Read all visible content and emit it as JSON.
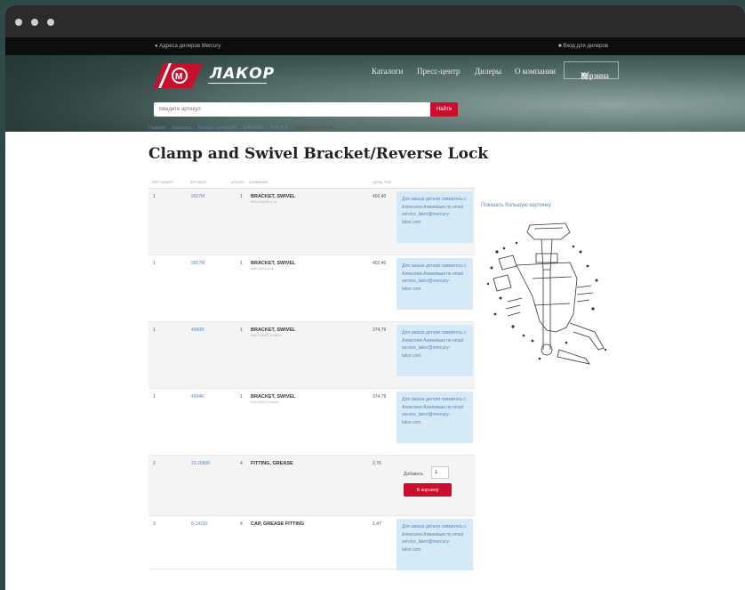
{
  "topbar": {
    "dealers_address": "Адреса дилеров Mercury",
    "dealer_login": "Вход для дилеров"
  },
  "header": {
    "logo_text": "ЛАКОР",
    "nav": [
      "Каталоги",
      "Пресс-центр",
      "Дилеры",
      "О компании"
    ],
    "cart_label": "Корзина",
    "search_placeholder": "Введите артикул",
    "search_button": "Найти"
  },
  "breadcrumb": {
    "items": [
      "Главная",
      "Каталоги",
      "Каталог запчастей",
      "MARINER",
      "6 X2 H.P."
    ],
    "separator": "→",
    "current": "Группы запчастей"
  },
  "page_title": "Clamp and Swivel Bracket/Reverse Lock",
  "table": {
    "headers": [
      "Ref номер",
      "Артикул",
      "Кол-во",
      "Название",
      "Цена, руб"
    ],
    "rows": [
      {
        "ref": "1",
        "article": "9927M",
        "qty": "1",
        "name": "BRACKET, SWIVEL",
        "sub": "SN# 0-0D000 & up",
        "price": "402,40",
        "note": "Для заказа детали свяжитесь с Алексеем Ахмеевым по email service_lakor@mercury-lakor.com"
      },
      {
        "ref": "1",
        "article": "9927M",
        "qty": "1",
        "name": "BRACKET, SWIVEL",
        "sub": "SN# 0D000 & up",
        "price": "402,40",
        "note": "Для заказа детали свяжитесь с Алексеем Ахмеевым по email service_lakor@mercury-lakor.com"
      },
      {
        "ref": "1",
        "article": "4990R",
        "qty": "1",
        "name": "BRACKET, SWIVEL",
        "sub": "SN# 0-0D001 & below",
        "price": "374,79",
        "note": "Для заказа детали свяжитесь с Алексеем Ахмеевым по email service_lakor@mercury-lakor.com"
      },
      {
        "ref": "1",
        "article": "4994R",
        "qty": "1",
        "name": "BRACKET, SWIVEL",
        "sub": "SN# 0D001 & below",
        "price": "374,79",
        "note": "Для заказа детали свяжитесь с Алексеем Ахмеевым по email service_lakor@mercury-lakor.com"
      },
      {
        "ref": "2",
        "article": "22-26890",
        "qty": "4",
        "name": "FITTING, GREASE",
        "sub": "",
        "price": "2,76",
        "qty_label": "Добавить",
        "qty_value": "1",
        "cart_button": "В корзину"
      },
      {
        "ref": "3",
        "article": "8-14330",
        "qty": "4",
        "name": "CAP, GREASE FITTING",
        "sub": "",
        "price": "1,47",
        "note": "Для заказа детали свяжитесь с Алексеем Ахмеевым по email service_lakor@mercury-lakor.com"
      }
    ]
  },
  "diagram": {
    "link_text": "Показать большую картинку"
  },
  "colors": {
    "accent": "#c8102e",
    "link": "#5a86b8",
    "note_bg": "#d6e9f7"
  }
}
